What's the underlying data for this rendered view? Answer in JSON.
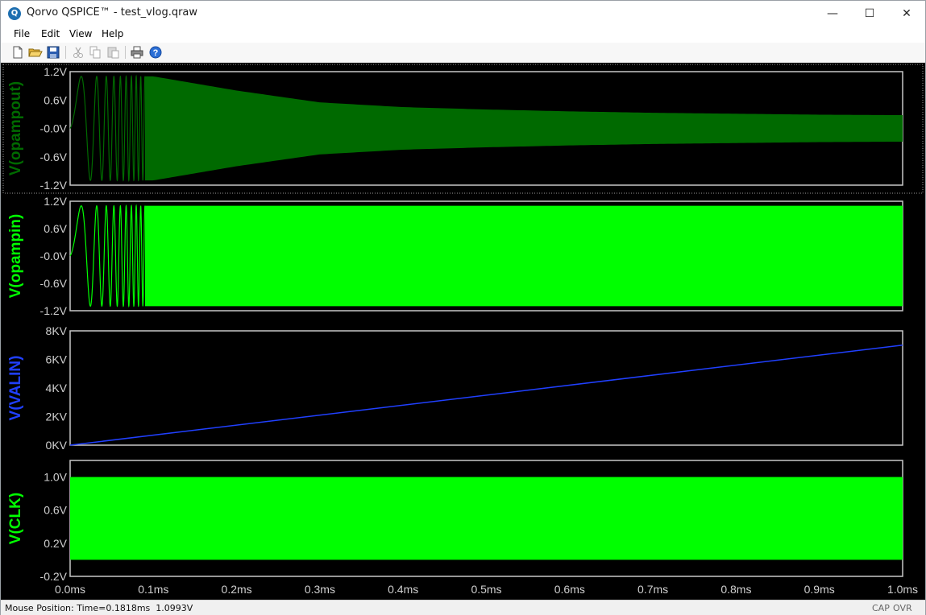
{
  "window": {
    "title": "Qorvo QSPICE™ - test_vlog.qraw",
    "app_icon_letter": "Q",
    "minimize_glyph": "—",
    "maximize_glyph": "☐",
    "close_glyph": "✕"
  },
  "menu": [
    "File",
    "Edit",
    "View",
    "Help"
  ],
  "toolbar": {
    "icons": [
      "new-file-icon",
      "open-folder-icon",
      "save-icon",
      "cut-icon",
      "copy-icon",
      "paste-icon",
      "print-icon",
      "help-icon"
    ]
  },
  "colors": {
    "dark_green": "#006a00",
    "bright_green": "#00ff00",
    "blue": "#2040ff",
    "frame": "#c8c8c8",
    "text_gray": "#cfcfcf"
  },
  "x_axis": {
    "ticks": [
      "0.0ms",
      "0.1ms",
      "0.2ms",
      "0.3ms",
      "0.4ms",
      "0.5ms",
      "0.6ms",
      "0.7ms",
      "0.8ms",
      "0.9ms",
      "1.0ms"
    ]
  },
  "chart_data": [
    {
      "type": "line",
      "name": "V(opampout)",
      "color": "#006a00",
      "ylabel": "V(opampout)",
      "y_ticks": [
        "1.2V",
        "0.6V",
        "-0.0V",
        "-0.6V",
        "-1.2V"
      ],
      "ylim": [
        -1.2,
        1.2
      ],
      "xlim": [
        0,
        1.0
      ],
      "x_unit": "ms",
      "description_values": {
        "signal": "chirp sine, amplitude decaying",
        "amplitude_envelope": [
          [
            0.0,
            1.1
          ],
          [
            0.1,
            1.1
          ],
          [
            0.2,
            0.8
          ],
          [
            0.3,
            0.55
          ],
          [
            0.4,
            0.45
          ],
          [
            0.5,
            0.4
          ],
          [
            0.6,
            0.36
          ],
          [
            0.7,
            0.33
          ],
          [
            0.8,
            0.31
          ],
          [
            0.9,
            0.29
          ],
          [
            1.0,
            0.28
          ]
        ]
      }
    },
    {
      "type": "line",
      "name": "V(opampin)",
      "color": "#00ff00",
      "ylabel": "V(opampin)",
      "y_ticks": [
        "1.2V",
        "0.6V",
        "-0.0V",
        "-0.6V",
        "-1.2V"
      ],
      "ylim": [
        -1.2,
        1.2
      ],
      "xlim": [
        0,
        1.0
      ],
      "x_unit": "ms",
      "description_values": {
        "signal": "chirp sine, constant amplitude",
        "amplitude_envelope": [
          [
            0.0,
            1.1
          ],
          [
            1.0,
            1.1
          ]
        ]
      }
    },
    {
      "type": "line",
      "name": "V(VALIN)",
      "color": "#2040ff",
      "ylabel": "V(VALIN)",
      "y_ticks": [
        "8KV",
        "6KV",
        "4KV",
        "2KV",
        "0KV"
      ],
      "ylim": [
        0,
        8000
      ],
      "xlim": [
        0,
        1.0
      ],
      "x_unit": "ms",
      "x": [
        0.0,
        1.0
      ],
      "y": [
        0,
        7000
      ]
    },
    {
      "type": "area",
      "name": "V(CLK)",
      "color": "#00ff00",
      "ylabel": "V(CLK)",
      "y_ticks": [
        "1.0V",
        "0.6V",
        "0.2V",
        "-0.2V"
      ],
      "ylim": [
        -0.2,
        1.2
      ],
      "xlim": [
        0,
        1.0
      ],
      "x_unit": "ms",
      "band": [
        0.0,
        1.0
      ]
    }
  ],
  "status": {
    "text": "Mouse Position: Time=0.1818ms  1.0993V",
    "cap": "CAP",
    "ovr": "OVR"
  }
}
